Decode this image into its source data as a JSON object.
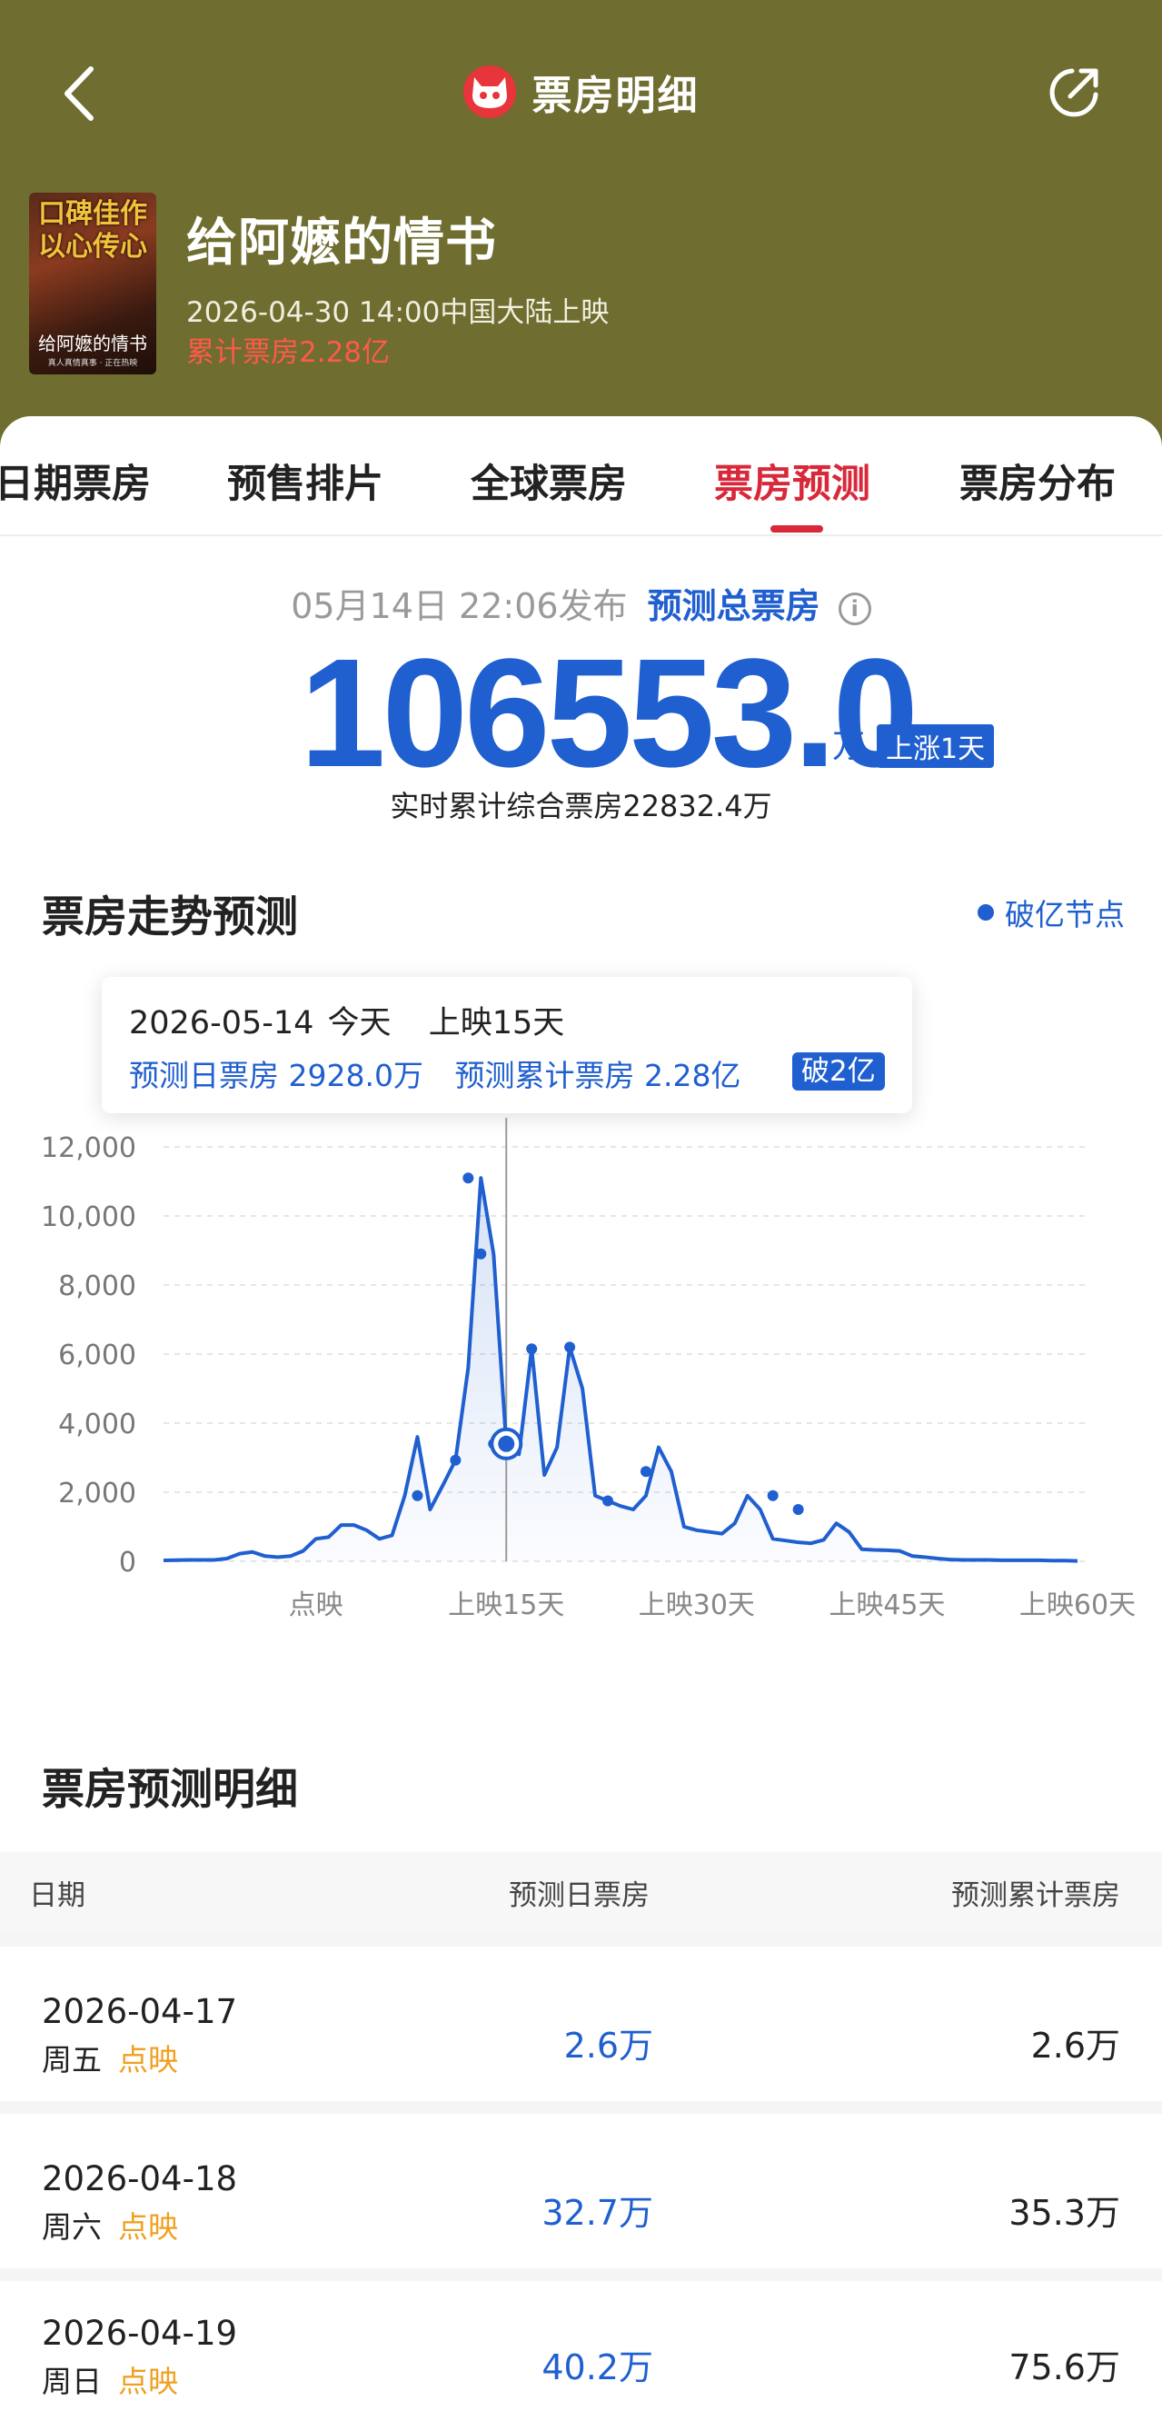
{
  "header": {
    "title": "票房明细",
    "icons": {
      "back": "chevron-left-icon",
      "logo": "cat-logo-icon",
      "share": "share-icon"
    }
  },
  "movie": {
    "title": "给阿嬷的情书",
    "release": "2026-04-30 14:00中国大陆上映",
    "cumulative": "累计票房2.28亿",
    "poster": {
      "headline_line1": "口碑佳作",
      "headline_line2": "以心传心",
      "title": "给阿嬷的情书",
      "tagline": "真人真情真事 · 正在热映"
    }
  },
  "tabs": [
    {
      "label": "日期票房",
      "active": false
    },
    {
      "label": "预售排片",
      "active": false
    },
    {
      "label": "全球票房",
      "active": false
    },
    {
      "label": "票房预测",
      "active": true
    },
    {
      "label": "票房分布",
      "active": false
    }
  ],
  "forecast": {
    "publish_time": "05月14日 22:06发布",
    "label": "预测总票房",
    "total": "106553.0",
    "unit": "万",
    "change_badge": "上涨1天",
    "realtime": "实时累计综合票房22832.4万"
  },
  "trend": {
    "title": "票房走势预测",
    "legend": "破亿节点",
    "tooltip": {
      "date": "2026-05-14",
      "day_label": "今天",
      "days_label": "上映15天",
      "daily": "预测日票房 2928.0万",
      "cumulative": "预测累计票房 2.28亿",
      "badge": "破2亿"
    }
  },
  "chart_data": {
    "type": "area",
    "ylim": [
      0,
      12000
    ],
    "yticks": [
      "12,000",
      "10,000",
      "8,000",
      "6,000",
      "4,000",
      "2,000",
      "0"
    ],
    "ytick_values": [
      12000,
      10000,
      8000,
      6000,
      4000,
      2000,
      0
    ],
    "xticks": [
      {
        "label": "点映",
        "x": 0
      },
      {
        "label": "上映15天",
        "x": 15
      },
      {
        "label": "上映30天",
        "x": 30
      },
      {
        "label": "上映45天",
        "x": 45
      },
      {
        "label": "上映60天",
        "x": 60
      }
    ],
    "xlim": [
      -12,
      61
    ],
    "grid": true,
    "highlight_x": 15,
    "series": [
      {
        "x": [
          -12,
          -10,
          -8,
          -7,
          -6,
          -5,
          -4,
          -3,
          -2,
          -1,
          0,
          1,
          2,
          3,
          4,
          5,
          6,
          7,
          8,
          9,
          10,
          11,
          12,
          13,
          14,
          15,
          16,
          17,
          18,
          19,
          20,
          21,
          22,
          23,
          24,
          25,
          26,
          27,
          28,
          29,
          30,
          31,
          32,
          33,
          34,
          35,
          36,
          37,
          38,
          39,
          40,
          41,
          42,
          43,
          44,
          45,
          46,
          47,
          48,
          49,
          50,
          51,
          52,
          53,
          54,
          55,
          56,
          57,
          58,
          59,
          60
        ],
        "y": [
          26,
          40,
          40,
          80,
          220,
          270,
          150,
          120,
          150,
          300,
          650,
          700,
          1050,
          1050,
          900,
          650,
          750,
          1900,
          3600,
          1500,
          2200,
          2928,
          5600,
          11100,
          8900,
          3400,
          3100,
          6150,
          2500,
          3300,
          6200,
          5000,
          1900,
          1750,
          1600,
          1500,
          1900,
          3300,
          2600,
          1000,
          900,
          850,
          800,
          1100,
          1900,
          1500,
          650,
          600,
          550,
          520,
          620,
          1100,
          850,
          350,
          330,
          320,
          300,
          150,
          120,
          80,
          50,
          40,
          40,
          40,
          30,
          30,
          30,
          30,
          20,
          20,
          10
        ],
        "markers_x": [
          8,
          11,
          12,
          13,
          14,
          15,
          17,
          20,
          23,
          26,
          36,
          38
        ],
        "markers_y": [
          1900,
          2928,
          11100,
          8900,
          3400,
          3100,
          6150,
          6200,
          1750,
          2600,
          1900,
          1500
        ]
      }
    ]
  },
  "detail": {
    "title": "票房预测明细",
    "headers": {
      "date": "日期",
      "daily": "预测日票房",
      "cumulative": "预测累计票房"
    },
    "rows": [
      {
        "date": "2026-04-17",
        "weekday": "周五",
        "tag": "点映",
        "daily": "2.6万",
        "cumulative": "2.6万"
      },
      {
        "date": "2026-04-18",
        "weekday": "周六",
        "tag": "点映",
        "daily": "32.7万",
        "cumulative": "35.3万"
      },
      {
        "date": "2026-04-19",
        "weekday": "周日",
        "tag": "点映",
        "daily": "40.2万",
        "cumulative": "75.6万"
      }
    ]
  },
  "colors": {
    "header_bg": "#6f6d2f",
    "accent_blue": "#1f5fcf",
    "accent_red": "#d8283a",
    "tag_orange": "#f0a020",
    "cumulative_red": "#ff5a4a"
  }
}
